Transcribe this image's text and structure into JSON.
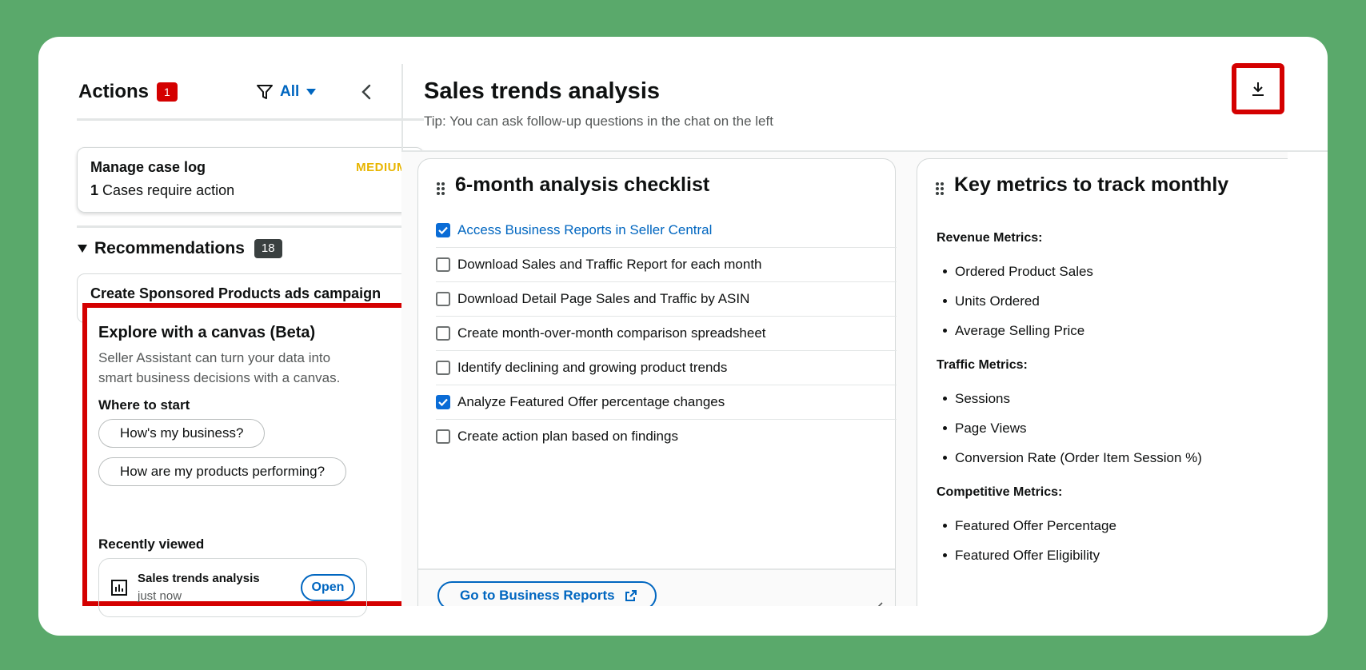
{
  "actions": {
    "title": "Actions",
    "count": "1",
    "filter_label": "All"
  },
  "case_card": {
    "title": "Manage case log",
    "priority": "MEDIUM",
    "count": "1",
    "subtitle": "Cases require action"
  },
  "recommendations": {
    "label": "Recommendations",
    "count": "18",
    "behind_card_text": "Create Sponsored Products ads campaign"
  },
  "canvas_promo": {
    "title": "Explore with a canvas (Beta)",
    "description": "Seller Assistant can turn your data into smart business decisions with a canvas.",
    "where_to_start": "Where to start",
    "chips": [
      "How's my business?",
      "How are my products performing?"
    ],
    "recently_viewed": "Recently viewed",
    "recent_item": {
      "title": "Sales trends analysis",
      "time": "just now",
      "open_label": "Open"
    }
  },
  "page": {
    "title": "Sales trends analysis",
    "tip": "Tip: You can ask follow-up questions in the chat on the left"
  },
  "checklist": {
    "title": "6-month analysis checklist",
    "items": [
      {
        "label": "Access Business Reports in Seller Central",
        "checked": true,
        "link": true
      },
      {
        "label": "Download Sales and Traffic Report for each month",
        "checked": false
      },
      {
        "label": "Download Detail Page Sales and Traffic by ASIN",
        "checked": false
      },
      {
        "label": "Create month-over-month comparison spreadsheet",
        "checked": false
      },
      {
        "label": "Identify declining and growing product trends",
        "checked": false
      },
      {
        "label": "Analyze Featured Offer percentage changes",
        "checked": true
      },
      {
        "label": "Create action plan based on findings",
        "checked": false
      }
    ],
    "button_label": "Go to Business Reports"
  },
  "key_metrics": {
    "title": "Key metrics to track monthly",
    "groups": [
      {
        "heading": "Revenue Metrics:",
        "items": [
          "Ordered Product Sales",
          "Units Ordered",
          "Average Selling Price"
        ]
      },
      {
        "heading": "Traffic Metrics:",
        "items": [
          "Sessions",
          "Page Views",
          "Conversion Rate (Order Item Session %)"
        ]
      },
      {
        "heading": "Competitive Metrics:",
        "items": [
          "Featured Offer Percentage",
          "Featured Offer Eligibility"
        ]
      }
    ]
  },
  "colors": {
    "background": "#5aa96b",
    "highlight": "#d40000",
    "link": "#0066c0",
    "checkbox": "#0a6cd6",
    "priority": "#e8b500"
  }
}
